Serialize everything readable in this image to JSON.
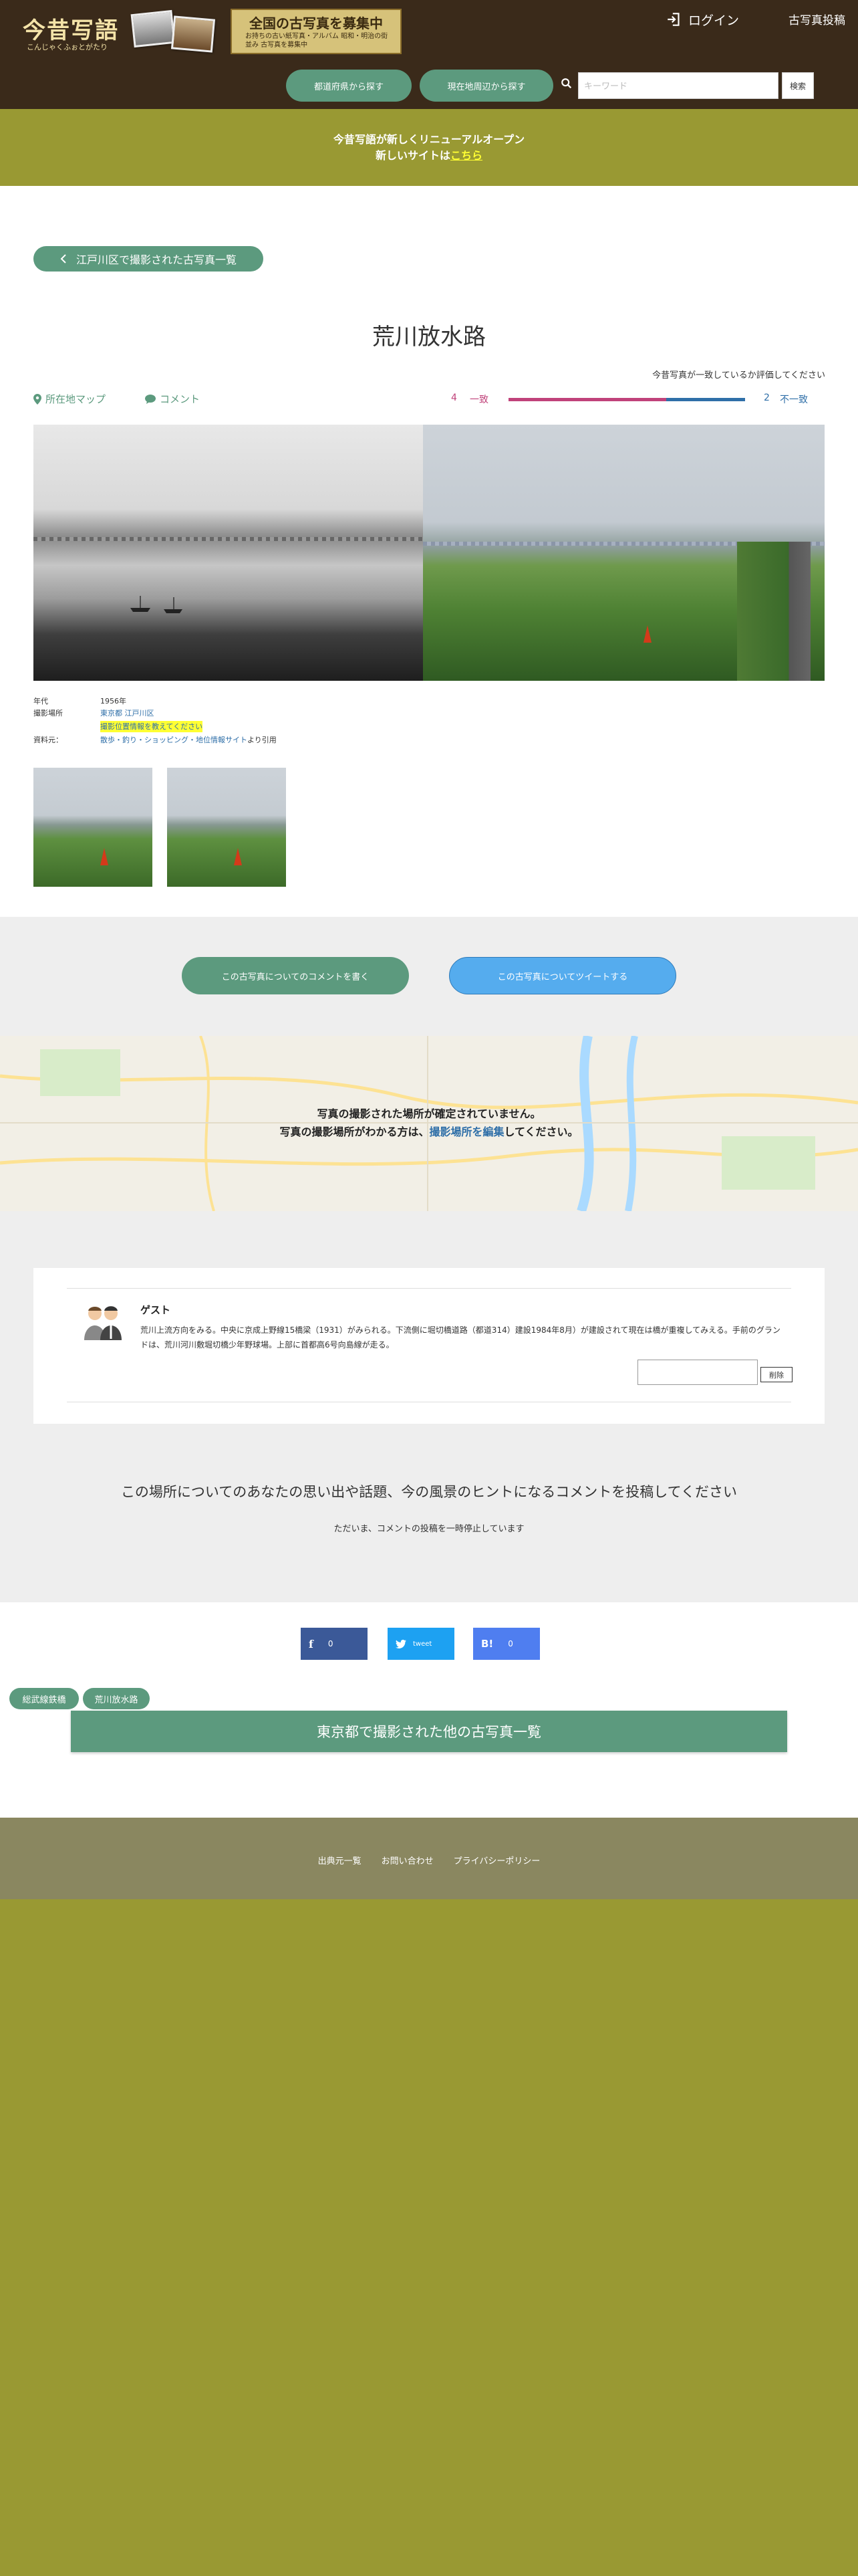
{
  "header": {
    "logo_main": "今昔写語",
    "logo_sub": "こんじゃくふぉとがたり",
    "banner_title": "全国の古写真を募集中",
    "banner_sub": "お持ちの古い紙写真・アルバム 昭和・明治の街並み 古写真を募集中",
    "login_label": "ログイン",
    "post_label": "古写真投稿"
  },
  "nav": {
    "by_prefecture": "都道府県から探す",
    "nearby": "現在地周辺から探す",
    "search_placeholder": "キーワード",
    "search_button": "検索"
  },
  "notice": {
    "line1": "今昔写語が新しくリニューアルオープン",
    "line2_prefix": "新しいサイトは",
    "line2_link": "こちら"
  },
  "photo_page": {
    "back_label": "江戸川区で撮影された古写真一覧",
    "title": "荒川放水路",
    "rate_prompt": "今昔写真が一致しているか評価してください",
    "map_label": "所在地マップ",
    "comment_label": "コメント",
    "rating": {
      "match_count": "4",
      "match_label": "一致",
      "mismatch_count": "2",
      "mismatch_label": "不一致",
      "match_fraction": 0.667
    }
  },
  "meta": {
    "year_label": "年代",
    "year_value": "1956年",
    "place_label": "撮影場所",
    "place_value": "東京都 江戸川区",
    "place_note": "撮影位置情報を教えてください",
    "source_label": "資料元：",
    "source_link": "散歩・釣り・ショッピング・地位情報サイト",
    "source_suffix": "より引用"
  },
  "actions": {
    "write_comment": "この古写真についてのコメントを書く",
    "tweet": "この古写真についてツイートする"
  },
  "map_notice": {
    "line1": "写真の撮影された場所が確定されていません。",
    "line2_prefix": "写真の撮影場所がわかる方は、",
    "line2_link": "撮影場所を編集",
    "line2_suffix": "してください。"
  },
  "comment": {
    "author": "ゲスト",
    "body": "荒川上流方向をみる。中央に京成上野線15橋梁（1931）がみられる。下流側に堀切橋道路（都道314）建設1984年8月）が建設されて現在は橋が重複してみえる。手前のグランドは、荒川河川敷堀切橋少年野球場。上部に首都高6号向島線が走る。",
    "delete_button": "削除"
  },
  "cta": {
    "title": "この場所についてのあなたの思い出や話題、今の風景のヒントになるコメントを投稿してください",
    "note": "ただいま、コメントの投稿を一時停止しています"
  },
  "share": {
    "fb_icon": "f",
    "fb_count": "0",
    "tw_label": "tweet",
    "hb_icon": "B!",
    "hb_count": "0"
  },
  "tags": [
    "総武線鉄橋",
    "荒川放水路"
  ],
  "more_list": "東京都で撮影された他の古写真一覧",
  "footer": {
    "links": [
      "出典元一覧",
      "お問い合わせ",
      "プライバシーポリシー"
    ]
  },
  "colors": {
    "accent": "#5c9a7e",
    "header_bg": "#3a2a1a",
    "olive": "#999933",
    "match": "#c0427a",
    "mismatch": "#2f6fa8"
  }
}
